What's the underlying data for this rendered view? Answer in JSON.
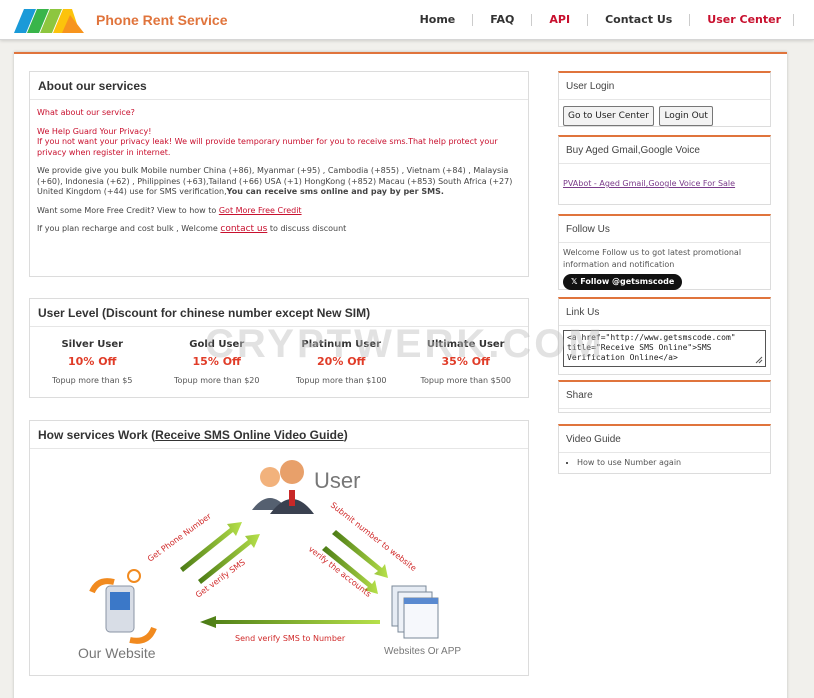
{
  "header": {
    "brand": "Phone Rent Service",
    "nav": [
      {
        "label": "Home",
        "color": "#333333"
      },
      {
        "label": "FAQ",
        "color": "#333333"
      },
      {
        "label": "API",
        "color": "#c8102e"
      },
      {
        "label": "Contact Us",
        "color": "#333333"
      },
      {
        "label": "User Center",
        "color": "#c8102e"
      }
    ]
  },
  "about": {
    "title": "About our services",
    "q": "What about our service?",
    "guard_line1": "We Help Guard Your Privacy!",
    "guard_line2": "If you not want your privacy leak! We will provide temporary number for you to receive sms.That help protect your privacy when register in internet.",
    "provide_text": "We provide give you bulk Mobile number China (+86), Myanmar (+95) , Cambodia (+855) , Vietnam (+84) , Malaysia (+60), Indonesia (+62) , Philippines (+63),Tailand (+66) USA (+1) HongKong (+852) Macau (+853) South Africa (+27) United Kingdom (+44) use for SMS verification,",
    "provide_bold": "You can receive sms online and pay by per SMS.",
    "credit_text": "Want some More Free Credit? View to how to",
    "credit_link": "Got More Free Credit",
    "recharge_text": "If you plan recharge and cost bulk , Welcome",
    "recharge_link": "contact us",
    "recharge_tail": "to discuss discount"
  },
  "levels": {
    "title": "User Level (Discount for chinese number except New SIM)",
    "items": [
      {
        "name": "Silver User",
        "off": "10% Off",
        "topup": "Topup more than $5"
      },
      {
        "name": "Gold User",
        "off": "15% Off",
        "topup": "Topup more than $20"
      },
      {
        "name": "Platinum User",
        "off": "20% Off",
        "topup": "Topup more than $100"
      },
      {
        "name": "Ultimate User",
        "off": "35% Off",
        "topup": "Topup more than $500"
      }
    ]
  },
  "how": {
    "title_prefix": "How services Work (",
    "title_link": "Receive SMS Online Video Guide",
    "title_suffix": ")",
    "user": "User",
    "our_website": "Our Website",
    "websites_app": "Websites Or APP",
    "get_phone": "Get Phone Number",
    "get_verify": "Get verify SMS",
    "submit": "Submit number to website",
    "verify_accounts": "verify the accounts",
    "send_verify": "Send verify SMS to Number"
  },
  "sidebar": {
    "login": {
      "title": "User Login",
      "btn_center": "Go to User Center",
      "btn_logout": "Login Out"
    },
    "aged": {
      "title": "Buy Aged Gmail,Google Voice",
      "link": "PVAbot - Aged Gmail,Google Voice For Sale"
    },
    "follow": {
      "title": "Follow Us",
      "text": "Welcome Follow us to got latest promotional information and notification",
      "x_button": "Follow @getsmscode"
    },
    "link": {
      "title": "Link Us",
      "code": "<a href=\"http://www.getsmscode.com\" title=\"Receive SMS Online\">SMS Verification Online</a>"
    },
    "share": {
      "title": "Share"
    },
    "video": {
      "title": "Video Guide",
      "items": [
        "How to use Number again"
      ]
    }
  },
  "watermark": "CRYPTWERK.COM"
}
